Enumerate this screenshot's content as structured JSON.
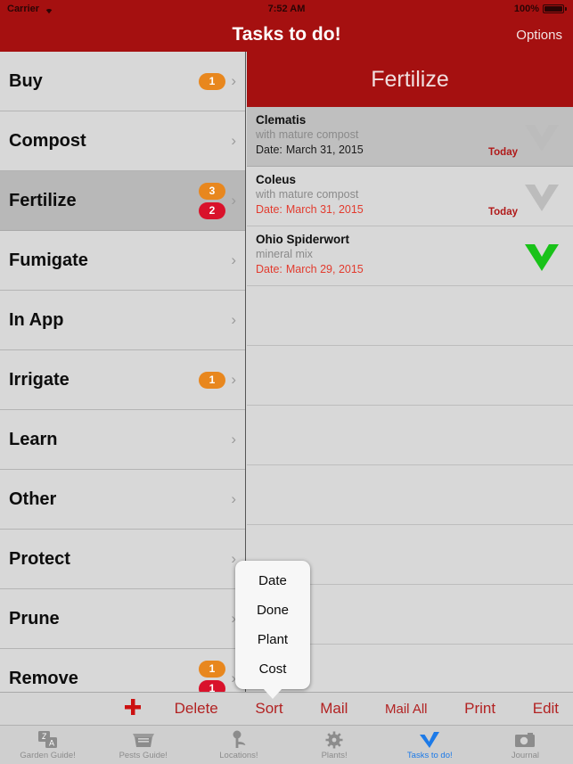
{
  "statusbar": {
    "carrier": "Carrier",
    "wifi_icon": "wifi-icon",
    "time": "7:52 AM",
    "battery_percent": "100%",
    "battery_icon": "battery-full-icon"
  },
  "navbar": {
    "title": "Tasks to do!",
    "options_label": "Options"
  },
  "sidebar": {
    "items": [
      {
        "label": "Buy",
        "badges": [
          {
            "value": "1",
            "color": "#e8871e"
          }
        ],
        "selected": false
      },
      {
        "label": "Compost",
        "badges": [],
        "selected": false
      },
      {
        "label": "Fertilize",
        "badges": [
          {
            "value": "3",
            "color": "#e8871e"
          },
          {
            "value": "2",
            "color": "#d9122b"
          }
        ],
        "selected": true
      },
      {
        "label": "Fumigate",
        "badges": [],
        "selected": false
      },
      {
        "label": "In App",
        "badges": [],
        "selected": false
      },
      {
        "label": "Irrigate",
        "badges": [
          {
            "value": "1",
            "color": "#e8871e"
          }
        ],
        "selected": false
      },
      {
        "label": "Learn",
        "badges": [],
        "selected": false
      },
      {
        "label": "Other",
        "badges": [],
        "selected": false
      },
      {
        "label": "Protect",
        "badges": [],
        "selected": false
      },
      {
        "label": "Prune",
        "badges": [],
        "selected": false
      },
      {
        "label": "Remove",
        "badges": [
          {
            "value": "1",
            "color": "#e8871e"
          },
          {
            "value": "1",
            "color": "#d9122b"
          }
        ],
        "selected": false
      }
    ],
    "disclosure_icon": "chevron-right-icon"
  },
  "detail": {
    "header_title": "Fertilize",
    "date_label": "Date:",
    "tasks": [
      {
        "plant": "Clematis",
        "note": "with mature compost",
        "date": "March 31, 2015",
        "date_color": "dark",
        "today_badge": "Today",
        "done": false,
        "check_color": "#bcbcbc",
        "selected": true
      },
      {
        "plant": "Coleus",
        "note": "with mature compost",
        "date": "March 31, 2015",
        "date_color": "red",
        "today_badge": "Today",
        "done": false,
        "check_color": "#bcbcbc",
        "selected": false
      },
      {
        "plant": "Ohio Spiderwort",
        "note": "mineral mix",
        "date": "March 29, 2015",
        "date_color": "red",
        "today_badge": "",
        "done": true,
        "check_color": "#19c219",
        "selected": false
      }
    ],
    "empty_row_count": 7
  },
  "popover": {
    "items": [
      {
        "label": "Date"
      },
      {
        "label": "Done"
      },
      {
        "label": "Plant"
      },
      {
        "label": "Cost"
      }
    ]
  },
  "toolbar": {
    "add_icon": "plus-icon",
    "items": [
      {
        "label": "Delete",
        "size": "normal"
      },
      {
        "label": "Sort",
        "size": "normal"
      },
      {
        "label": "Mail",
        "size": "normal"
      },
      {
        "label": "Mail All",
        "size": "small"
      },
      {
        "label": "Print",
        "size": "normal"
      },
      {
        "label": "Edit",
        "size": "normal"
      }
    ],
    "accent_color": "#b22222"
  },
  "tabbar": {
    "active_color": "#1c7ae8",
    "tabs": [
      {
        "label": "Garden Guide!",
        "icon": "translate-icon",
        "active": false
      },
      {
        "label": "Pests Guide!",
        "icon": "box-icon",
        "active": false
      },
      {
        "label": "Locations!",
        "icon": "pin-icon",
        "active": false
      },
      {
        "label": "Plants!",
        "icon": "gear-flower-icon",
        "active": false
      },
      {
        "label": "Tasks to do!",
        "icon": "check-icon",
        "active": true
      },
      {
        "label": "Journal",
        "icon": "camera-icon",
        "active": false
      }
    ]
  }
}
